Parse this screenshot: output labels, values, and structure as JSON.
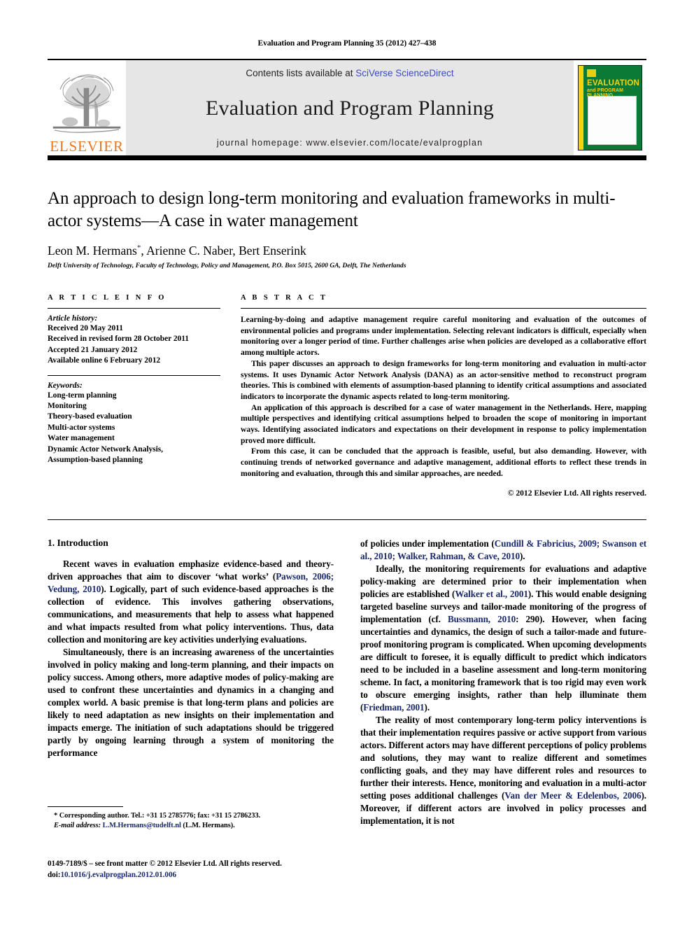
{
  "running_head": "Evaluation and Program Planning 35 (2012) 427–438",
  "masthead": {
    "contents_prefix": "Contents lists available at ",
    "contents_link": "SciVerse ScienceDirect",
    "journal_title": "Evaluation and Program Planning",
    "homepage": "journal homepage: www.elsevier.com/locate/evalprogplan",
    "publisher_wordmark": "ELSEVIER",
    "publisher_color": "#E87722",
    "cover": {
      "line1": "EVALUATION",
      "line2": "and PROGRAM PLANNING",
      "bg_color": "#0b7a36",
      "text_color": "#f5d310"
    }
  },
  "article": {
    "title": "An approach to design long-term monitoring and evaluation frameworks in multi-actor systems—A case in water management",
    "authors": "Leon M. Hermans, Arienne C. Naber, Bert Enserink",
    "author_marker": "*",
    "affiliation": "Delft University of Technology, Faculty of Technology, Policy and Management, P.O. Box 5015, 2600 GA, Delft, The Netherlands"
  },
  "article_info": {
    "heading": "A R T I C L E   I N F O",
    "history_label": "Article history:",
    "history": [
      "Received 20 May 2011",
      "Received in revised form 28 October 2011",
      "Accepted 21 January 2012",
      "Available online 6 February 2012"
    ],
    "keywords_label": "Keywords:",
    "keywords": [
      "Long-term planning",
      "Monitoring",
      "Theory-based evaluation",
      "Multi-actor systems",
      "Water management",
      "Dynamic Actor Network Analysis,",
      "Assumption-based planning"
    ]
  },
  "abstract": {
    "heading": "A B S T R A C T",
    "paragraphs": [
      "Learning-by-doing and adaptive management require careful monitoring and evaluation of the outcomes of environmental policies and programs under implementation. Selecting relevant indicators is difficult, especially when monitoring over a longer period of time. Further challenges arise when policies are developed as a collaborative effort among multiple actors.",
      "This paper discusses an approach to design frameworks for long-term monitoring and evaluation in multi-actor systems. It uses Dynamic Actor Network Analysis (DANA) as an actor-sensitive method to reconstruct program theories. This is combined with elements of assumption-based planning to identify critical assumptions and associated indicators to incorporate the dynamic aspects related to long-term monitoring.",
      "An application of this approach is described for a case of water management in the Netherlands. Here, mapping multiple perspectives and identifying critical assumptions helped to broaden the scope of monitoring in important ways. Identifying associated indicators and expectations on their development in response to policy implementation proved more difficult.",
      "From this case, it can be concluded that the approach is feasible, useful, but also demanding. However, with continuing trends of networked governance and adaptive management, additional efforts to reflect these trends in monitoring and evaluation, through this and similar approaches, are needed."
    ],
    "copyright": "© 2012 Elsevier Ltd. All rights reserved."
  },
  "body": {
    "section_number_title": "1. Introduction",
    "left_paragraphs": [
      {
        "segments": [
          {
            "text": "Recent waves in evaluation emphasize evidence-based and theory-driven approaches that aim to discover ‘what works’ (",
            "type": "plain"
          },
          {
            "text": "Pawson, 2006; Vedung, 2010",
            "type": "cite"
          },
          {
            "text": "). Logically, part of such evidence-based approaches is the collection of evidence. This involves gathering observations, communications, and measurements that help to assess what happened and what impacts resulted from what policy interventions. Thus, data collection and monitoring are key activities underlying evaluations.",
            "type": "plain"
          }
        ]
      },
      {
        "segments": [
          {
            "text": "Simultaneously, there is an increasing awareness of the uncertainties involved in policy making and long-term planning, and their impacts on policy success. Among others, more adaptive modes of policy-making are used to confront these uncertainties and dynamics in a changing and complex world. A basic premise is that long-term plans and policies are likely to need adaptation as new insights on their implementation and impacts emerge. The initiation of such adaptations should be triggered partly by ongoing learning through a system of monitoring the performance",
            "type": "plain"
          }
        ]
      }
    ],
    "right_paragraphs": [
      {
        "continued": true,
        "segments": [
          {
            "text": "of policies under implementation (",
            "type": "plain"
          },
          {
            "text": "Cundill & Fabricius, 2009; Swanson et al., 2010; Walker, Rahman, & Cave, 2010",
            "type": "cite"
          },
          {
            "text": ").",
            "type": "plain"
          }
        ]
      },
      {
        "continued": false,
        "segments": [
          {
            "text": "Ideally, the monitoring requirements for evaluations and adaptive policy-making are determined prior to their implementation when policies are established (",
            "type": "plain"
          },
          {
            "text": "Walker et al., 2001",
            "type": "cite"
          },
          {
            "text": "). This would enable designing targeted baseline surveys and tailor-made monitoring of the progress of implementation (cf. ",
            "type": "plain"
          },
          {
            "text": "Bussmann, 2010",
            "type": "cite"
          },
          {
            "text": ": 290). However, when facing uncertainties and dynamics, the design of such a tailor-made and future-proof monitoring program is complicated. When upcoming developments are difficult to foresee, it is equally difficult to predict which indicators need to be included in a baseline assessment and long-term monitoring scheme. In fact, a monitoring framework that is too rigid may even work to obscure emerging insights, rather than help illuminate them (",
            "type": "plain"
          },
          {
            "text": "Friedman, 2001",
            "type": "cite"
          },
          {
            "text": ").",
            "type": "plain"
          }
        ]
      },
      {
        "continued": false,
        "segments": [
          {
            "text": "The reality of most contemporary long-term policy interventions is that their implementation requires passive or active support from various actors. Different actors may have different perceptions of policy problems and solutions, they may want to realize different and sometimes conflicting goals, and they may have different roles and resources to further their interests. Hence, monitoring and evaluation in a multi-actor setting poses additional challenges (",
            "type": "plain"
          },
          {
            "text": "Van der Meer & Edelenbos, 2006",
            "type": "cite"
          },
          {
            "text": "). Moreover, if different actors are involved in policy processes and implementation, it is not",
            "type": "plain"
          }
        ]
      }
    ]
  },
  "footnotes": {
    "corresponding": "* Corresponding author. Tel.: +31 15 2785776; fax: +31 15 2786233.",
    "email_label": "E-mail address:",
    "email": "L.M.Hermans@tudelft.nl",
    "email_suffix": "(L.M. Hermans).",
    "front_matter": "0149-7189/$ – see front matter © 2012 Elsevier Ltd. All rights reserved.",
    "doi_label": "doi:",
    "doi": "10.1016/j.evalprogplan.2012.01.006"
  }
}
